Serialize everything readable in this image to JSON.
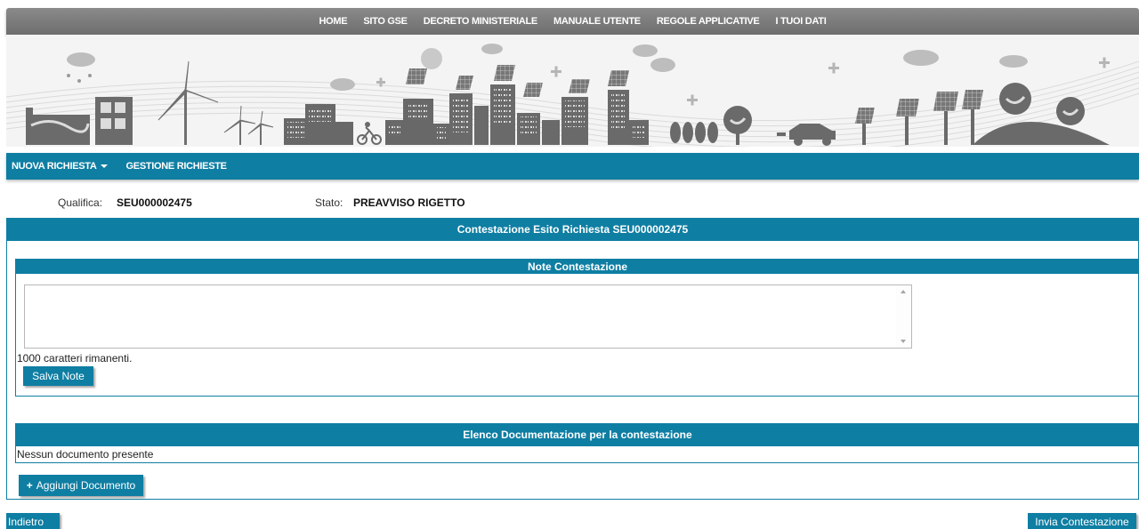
{
  "top_nav": [
    "HOME",
    "SITO GSE",
    "DECRETO MINISTERIALE",
    "MANUALE UTENTE",
    "REGOLE APPLICATIVE",
    "I TUOI DATI"
  ],
  "menu": {
    "nuova_richiesta": "NUOVA RICHIESTA",
    "gestione_richieste": "GESTIONE RICHIESTE"
  },
  "info": {
    "qualifica_label": "Qualifica:",
    "qualifica_value": "SEU000002475",
    "stato_label": "Stato:",
    "stato_value": "PREAVVISO RIGETTO"
  },
  "main": {
    "title": "Contestazione Esito Richiesta SEU000002475"
  },
  "notes": {
    "title": "Note Contestazione",
    "value": "",
    "chars_remaining": "1000 caratteri rimanenti.",
    "save_label": "Salva Note"
  },
  "documents": {
    "title": "Elenco Documentazione per la contestazione",
    "empty_text": "Nessun documento presente",
    "add_label": "Aggiungi Documento"
  },
  "footer": {
    "back_label": "Indietro",
    "send_label": "Invia Contestazione"
  },
  "colors": {
    "accent": "#0f7ea3",
    "nav_gray": "#7a7a7a"
  },
  "icons": {
    "add": "plus-icon",
    "dropdown": "caret-down-icon"
  }
}
